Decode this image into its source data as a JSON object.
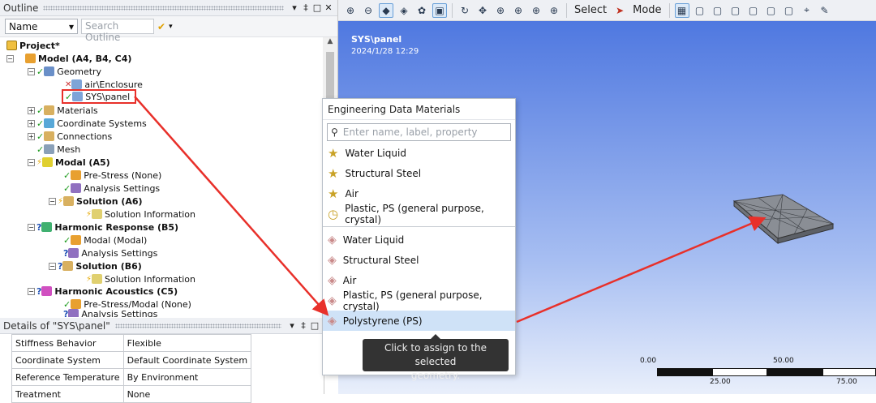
{
  "outline": {
    "title": "Outline",
    "controls": [
      "▾",
      "‡",
      "□",
      "✕"
    ],
    "name_select": "Name",
    "search_placeholder": "Search Outline",
    "tree": [
      {
        "label": "Project*",
        "bold": true
      },
      {
        "label": "Model (A4, B4, C4)",
        "bold": true
      },
      {
        "label": "Geometry",
        "bold": false
      },
      {
        "label": "air\\Enclosure",
        "bold": false
      },
      {
        "label": "SYS\\panel",
        "bold": false
      },
      {
        "label": "Materials",
        "bold": false
      },
      {
        "label": "Coordinate Systems",
        "bold": false
      },
      {
        "label": "Connections",
        "bold": false
      },
      {
        "label": "Mesh",
        "bold": false
      },
      {
        "label": "Modal (A5)",
        "bold": true
      },
      {
        "label": "Pre-Stress (None)",
        "bold": false
      },
      {
        "label": "Analysis Settings",
        "bold": false
      },
      {
        "label": "Solution (A6)",
        "bold": true
      },
      {
        "label": "Solution Information",
        "bold": false
      },
      {
        "label": "Harmonic Response (B5)",
        "bold": true
      },
      {
        "label": "Modal (Modal)",
        "bold": false
      },
      {
        "label": "Analysis Settings",
        "bold": false
      },
      {
        "label": "Solution (B6)",
        "bold": true
      },
      {
        "label": "Solution Information",
        "bold": false
      },
      {
        "label": "Harmonic Acoustics (C5)",
        "bold": true
      },
      {
        "label": "Pre-Stress/Modal (None)",
        "bold": false
      },
      {
        "label": "Analysis Settings",
        "bold": false
      }
    ]
  },
  "details": {
    "title": "Details of \"SYS\\panel\"",
    "rows": [
      {
        "key": "Stiffness Behavior",
        "value": "Flexible"
      },
      {
        "key": "Coordinate System",
        "value": "Default Coordinate System"
      },
      {
        "key": "Reference Temperature",
        "value": "By Environment"
      },
      {
        "key": "Treatment",
        "value": "None"
      }
    ]
  },
  "toolbar": {
    "select_label": "Select",
    "mode_label": "Mode"
  },
  "viewport": {
    "body_name": "SYS\\panel",
    "timestamp": "2024/1/28 12:29"
  },
  "materials_popup": {
    "title": "Engineering Data Materials",
    "search_placeholder": "Enter name, label, property",
    "favorites": [
      "Water Liquid",
      "Structural Steel",
      "Air"
    ],
    "recent": "Plastic, PS (general purpose, crystal)",
    "library": [
      "Water Liquid",
      "Structural Steel",
      "Air",
      "Plastic, PS (general purpose, crystal)",
      "Polystyrene (PS)"
    ],
    "tooltip_line1": "Click to assign to the selected",
    "tooltip_line2": "geometry."
  },
  "scale": {
    "labels_top": [
      "0.00",
      "50.00"
    ],
    "labels_bottom": [
      "25.00",
      "75.00"
    ]
  },
  "colors": {
    "annotation_red": "#e8302a",
    "selection_blue": "#cfe2f7",
    "viewport_top": "#4f78e0"
  }
}
